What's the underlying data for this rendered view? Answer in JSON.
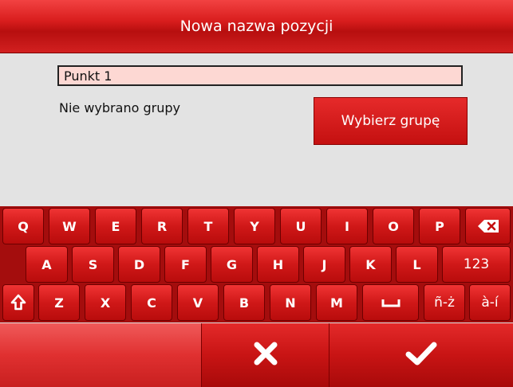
{
  "header": {
    "title": "Nowa nazwa pozycji"
  },
  "form": {
    "name_value": "Punkt 1",
    "group_status": "Nie wybrano grupy",
    "select_group_label": "Wybierz grupę"
  },
  "keyboard": {
    "row1": [
      "Q",
      "W",
      "E",
      "R",
      "T",
      "Y",
      "U",
      "I",
      "O",
      "P"
    ],
    "row2": [
      "A",
      "S",
      "D",
      "F",
      "G",
      "H",
      "J",
      "K",
      "L"
    ],
    "row3": [
      "Z",
      "X",
      "C",
      "V",
      "B",
      "N",
      "M"
    ],
    "numbers_label": "123",
    "accents_label_1": "ñ-ż",
    "accents_label_2": "à-í",
    "icons": {
      "backspace": "backspace-icon",
      "shift": "shift-icon",
      "space": "space-icon"
    }
  },
  "bottom_bar": {
    "cancel_icon": "close-icon",
    "ok_icon": "checkmark-icon"
  },
  "colors": {
    "accent_red": "#d01818",
    "input_background": "#fdd8d3",
    "page_background": "#e3e3e3"
  }
}
